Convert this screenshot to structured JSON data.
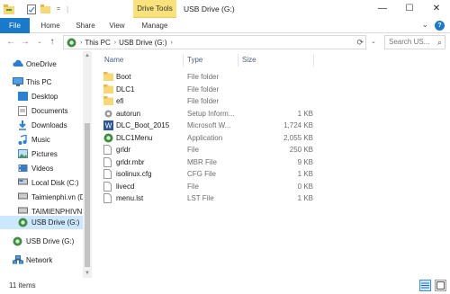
{
  "window": {
    "context_tab": "Drive Tools",
    "title": "USB Drive (G:)",
    "minimize": "—",
    "maximize": "☐",
    "close": "✕"
  },
  "ribbon": {
    "tabs": [
      "File",
      "Home",
      "Share",
      "View",
      "Manage"
    ],
    "help": "?"
  },
  "address": {
    "crumbs": [
      "This PC",
      "USB Drive (G:)"
    ],
    "search_placeholder": "Search US..."
  },
  "nav_pane": {
    "items": [
      {
        "label": "OneDrive",
        "icon": "cloud-icon"
      },
      {
        "label": "This PC",
        "icon": "computer-icon"
      },
      {
        "label": "Desktop",
        "icon": "desktop-folder-icon"
      },
      {
        "label": "Documents",
        "icon": "documents-folder-icon"
      },
      {
        "label": "Downloads",
        "icon": "downloads-folder-icon"
      },
      {
        "label": "Music",
        "icon": "music-folder-icon"
      },
      {
        "label": "Pictures",
        "icon": "pictures-folder-icon"
      },
      {
        "label": "Videos",
        "icon": "videos-folder-icon"
      },
      {
        "label": "Local Disk (C:)",
        "icon": "drive-icon"
      },
      {
        "label": "Taimienphi.vn (D",
        "icon": "drive-icon"
      },
      {
        "label": "TAIMIENPHIVN (",
        "icon": "drive-icon"
      },
      {
        "label": "USB Drive (G:)",
        "icon": "usb-drive-icon"
      },
      {
        "label": "USB Drive (G:)",
        "icon": "usb-drive-icon"
      },
      {
        "label": "Network",
        "icon": "network-icon"
      }
    ]
  },
  "file_list": {
    "columns": {
      "name": "Name",
      "type": "Type",
      "size": "Size"
    },
    "rows": [
      {
        "name": "Boot",
        "type": "File folder",
        "size": "",
        "icon": "folder-icon"
      },
      {
        "name": "DLC1",
        "type": "File folder",
        "size": "",
        "icon": "folder-icon"
      },
      {
        "name": "efi",
        "type": "File folder",
        "size": "",
        "icon": "folder-icon"
      },
      {
        "name": "autorun",
        "type": "Setup Inform...",
        "size": "1 KB",
        "icon": "settings-file-icon"
      },
      {
        "name": "DLC_Boot_2015",
        "type": "Microsoft W...",
        "size": "1,724 KB",
        "icon": "word-doc-icon"
      },
      {
        "name": "DLC1Menu",
        "type": "Application",
        "size": "2,055 KB",
        "icon": "app-icon"
      },
      {
        "name": "grldr",
        "type": "File",
        "size": "250 KB",
        "icon": "file-icon"
      },
      {
        "name": "grldr.mbr",
        "type": "MBR File",
        "size": "9 KB",
        "icon": "file-icon"
      },
      {
        "name": "isolinux.cfg",
        "type": "CFG File",
        "size": "1 KB",
        "icon": "file-icon"
      },
      {
        "name": "livecd",
        "type": "File",
        "size": "0 KB",
        "icon": "file-icon"
      },
      {
        "name": "menu.lst",
        "type": "LST File",
        "size": "1 KB",
        "icon": "file-icon"
      }
    ]
  },
  "status": {
    "item_count": "11 items"
  },
  "colors": {
    "accent": "#1979ca",
    "context_tab": "#f9e27b",
    "selection": "#cce8ff",
    "folder": "#f8d775"
  }
}
